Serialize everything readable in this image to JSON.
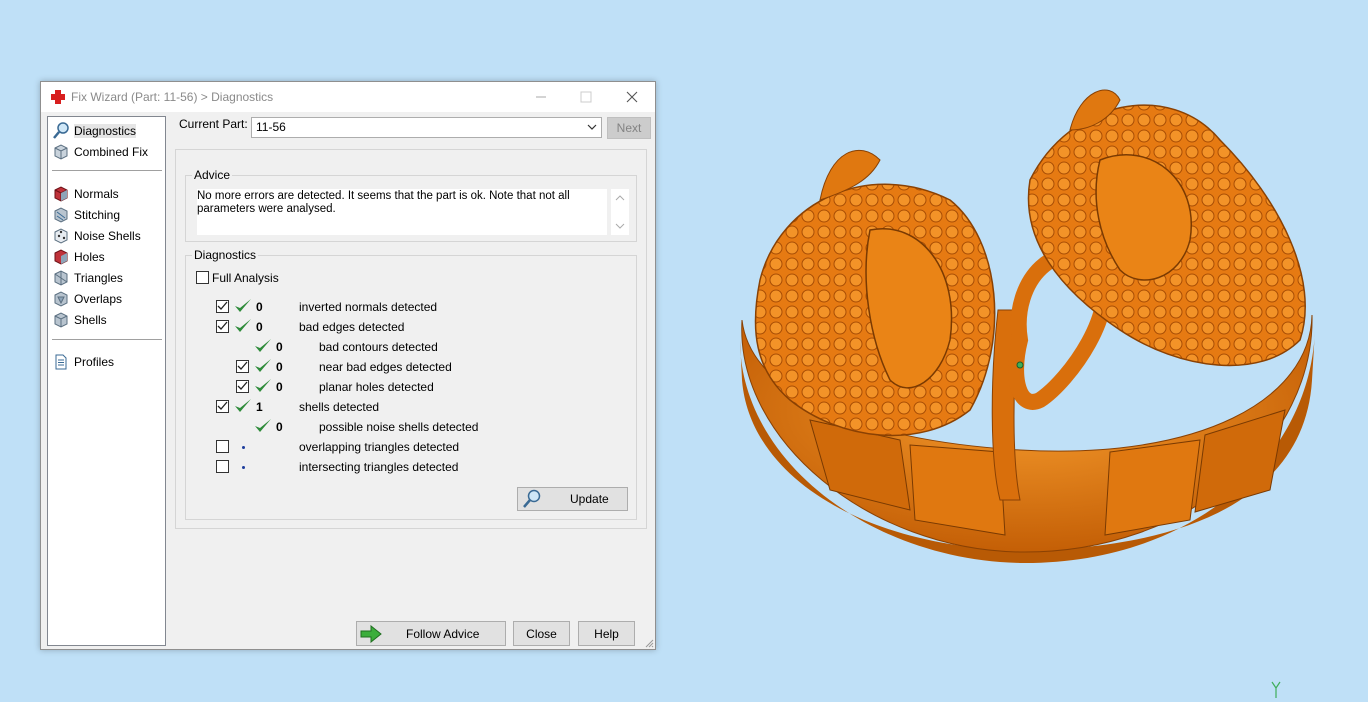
{
  "dialog": {
    "title": "Fix Wizard (Part: 11-56) > Diagnostics"
  },
  "sidebar": {
    "items": [
      {
        "label": "Diagnostics",
        "icon": "magnifier-icon"
      },
      {
        "label": "Combined Fix",
        "icon": "cube-icon"
      },
      {
        "label": "Normals",
        "icon": "normals-cube-icon"
      },
      {
        "label": "Stitching",
        "icon": "stitching-icon"
      },
      {
        "label": "Noise Shells",
        "icon": "dice-icon"
      },
      {
        "label": "Holes",
        "icon": "holes-cube-icon"
      },
      {
        "label": "Triangles",
        "icon": "triangles-icon"
      },
      {
        "label": "Overlaps",
        "icon": "overlaps-icon"
      },
      {
        "label": "Shells",
        "icon": "shells-icon"
      },
      {
        "label": "Profiles",
        "icon": "document-icon"
      }
    ]
  },
  "current_part": {
    "label": "Current Part:",
    "value": "11-56",
    "next_label": "Next"
  },
  "advice": {
    "title": "Advice",
    "text_line1": "No more errors are detected. It seems that the part is ok. Note that not all",
    "text_line2": "parameters were analysed."
  },
  "diagnostics": {
    "title": "Diagnostics",
    "full_analysis_label": "Full Analysis",
    "rows": [
      {
        "count": "0",
        "label": "inverted normals detected"
      },
      {
        "count": "0",
        "label": "bad edges detected"
      },
      {
        "count": "0",
        "label": "bad contours detected"
      },
      {
        "count": "0",
        "label": "near bad edges detected"
      },
      {
        "count": "0",
        "label": "planar holes detected"
      },
      {
        "count": "1",
        "label": "shells detected"
      },
      {
        "count": "0",
        "label": "possible noise shells detected"
      },
      {
        "count": "",
        "label": "overlapping triangles detected"
      },
      {
        "count": "",
        "label": "intersecting triangles detected"
      }
    ],
    "update_label": "Update"
  },
  "buttons": {
    "follow_advice": "Follow Advice",
    "close": "Close",
    "help": "Help"
  },
  "colors": {
    "model": "#e8780e",
    "viewport_bg": "#bfe0f7",
    "check_green": "#2e8b3a"
  }
}
